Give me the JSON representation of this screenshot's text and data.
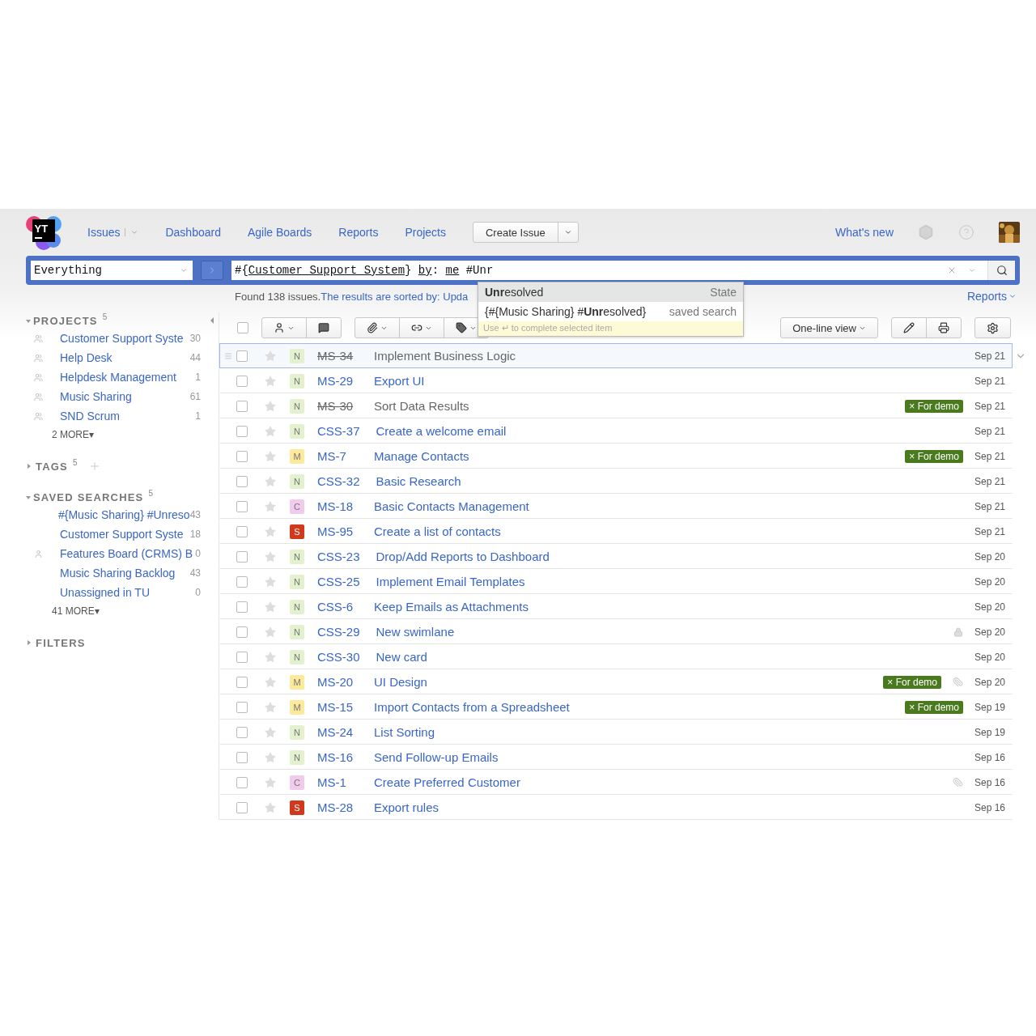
{
  "logo": {
    "text": "YT"
  },
  "nav": [
    {
      "label": "Issues",
      "has_menu": true
    },
    {
      "label": "Dashboard",
      "has_menu": false
    },
    {
      "label": "Agile Boards",
      "has_menu": false
    },
    {
      "label": "Reports",
      "has_menu": false
    },
    {
      "label": "Projects",
      "has_menu": false
    }
  ],
  "create_button": {
    "label": "Create Issue"
  },
  "whats_new": "What's new",
  "search": {
    "context": "Everything",
    "query": [
      {
        "text": "#{",
        "underlined": false
      },
      {
        "text": "Customer Support System",
        "underlined": true
      },
      {
        "text": "} ",
        "underlined": false
      },
      {
        "text": "by",
        "underlined": true
      },
      {
        "text": ": ",
        "underlined": false
      },
      {
        "text": "me",
        "underlined": true
      },
      {
        "text": " #Unr",
        "underlined": false
      }
    ]
  },
  "suggestions": {
    "items": [
      {
        "text": "**Unr**esolved",
        "type": "State",
        "selected": true
      },
      {
        "text": "{#{Music Sharing} #**Unr**esolved}",
        "type": "saved search",
        "selected": false
      }
    ],
    "hint": "Use ↵ to complete selected item"
  },
  "results": {
    "found": "Found 138 issues.",
    "sorted": "The results are sorted by: Upda",
    "reports": "Reports"
  },
  "sidebar": {
    "sections": [
      {
        "kind": "projects",
        "title": "PROJECTS",
        "count": "5",
        "expanded": true,
        "addable": false,
        "items": [
          {
            "name": "Customer Support Syste",
            "count": "30"
          },
          {
            "name": "Help Desk",
            "count": "44"
          },
          {
            "name": "Helpdesk Management",
            "count": "1"
          },
          {
            "name": "Music Sharing",
            "count": "61"
          },
          {
            "name": "SND Scrum",
            "count": "1"
          }
        ],
        "more": "2 MORE▾"
      },
      {
        "title": "TAGS",
        "count": "5",
        "expanded": false,
        "addable": true
      },
      {
        "kind": "searches",
        "title": "SAVED SEARCHES",
        "count": "5",
        "expanded": true,
        "addable": false,
        "items": [
          {
            "name": "#{Music Sharing} #Unreso",
            "count": "43",
            "kind": "shared"
          },
          {
            "name": "Customer Support Syste",
            "count": "18",
            "kind": "shared"
          },
          {
            "name": "Features Board (CRMS) B",
            "count": "0",
            "kind": "personal"
          },
          {
            "name": "Music Sharing Backlog",
            "count": "43",
            "kind": "shared"
          },
          {
            "name": "Unassigned in TU",
            "count": "0",
            "kind": "shared"
          }
        ],
        "more": "41 MORE▾"
      },
      {
        "title": "FILTERS",
        "expanded": false,
        "addable": false
      }
    ]
  },
  "select_all": {
    "checked": false
  },
  "view_button": "One-line view",
  "issues": [
    {
      "id": "MS-34",
      "summary": "Implement Business Logic",
      "priority": {
        "letter": "N",
        "color": "#e3f1cf"
      },
      "resolved": true,
      "selected": true,
      "checked": false,
      "locked": false,
      "attachment": false,
      "date": "Sep 21"
    },
    {
      "id": "MS-29",
      "summary": "Export UI",
      "priority": {
        "letter": "N",
        "color": "#e3f1cf"
      },
      "resolved": false,
      "selected": false,
      "checked": false,
      "locked": false,
      "attachment": false,
      "date": "Sep 21"
    },
    {
      "id": "MS-30",
      "summary": "Sort Data Results",
      "priority": {
        "letter": "N",
        "color": "#e3f1cf"
      },
      "resolved": true,
      "selected": false,
      "checked": false,
      "locked": false,
      "attachment": false,
      "tag": "× For demo",
      "date": "Sep 21"
    },
    {
      "id": "CSS-37",
      "summary": "Create a welcome email",
      "priority": {
        "letter": "N",
        "color": "#e3f1cf"
      },
      "resolved": false,
      "selected": false,
      "checked": false,
      "locked": false,
      "attachment": false,
      "date": "Sep 21"
    },
    {
      "id": "MS-7",
      "summary": "Manage Contacts",
      "priority": {
        "letter": "M",
        "color": "#fce99c"
      },
      "resolved": false,
      "selected": false,
      "checked": false,
      "locked": false,
      "attachment": false,
      "tag": "× For demo",
      "date": "Sep 21"
    },
    {
      "id": "CSS-32",
      "summary": "Basic Research",
      "priority": {
        "letter": "N",
        "color": "#e3f1cf"
      },
      "resolved": false,
      "selected": false,
      "checked": false,
      "locked": false,
      "attachment": false,
      "date": "Sep 21"
    },
    {
      "id": "MS-18",
      "summary": "Basic Contacts Management",
      "priority": {
        "letter": "C",
        "color": "#f1cbec"
      },
      "resolved": false,
      "selected": false,
      "checked": false,
      "locked": false,
      "attachment": false,
      "date": "Sep 21"
    },
    {
      "id": "MS-95",
      "summary": "Create a list of contacts",
      "priority": {
        "letter": "S",
        "color": "#cf3a1c"
      },
      "resolved": false,
      "selected": false,
      "checked": false,
      "locked": false,
      "attachment": false,
      "date": "Sep 21"
    },
    {
      "id": "CSS-23",
      "summary": "Drop/Add Reports to Dashboard",
      "priority": {
        "letter": "N",
        "color": "#e3f1cf"
      },
      "resolved": false,
      "selected": false,
      "checked": false,
      "locked": false,
      "attachment": false,
      "date": "Sep 20"
    },
    {
      "id": "CSS-25",
      "summary": "Implement Email Templates",
      "priority": {
        "letter": "N",
        "color": "#e3f1cf"
      },
      "resolved": false,
      "selected": false,
      "checked": false,
      "locked": false,
      "attachment": false,
      "date": "Sep 20"
    },
    {
      "id": "CSS-6",
      "summary": "Keep Emails as Attachments",
      "priority": {
        "letter": "N",
        "color": "#e3f1cf"
      },
      "resolved": false,
      "selected": false,
      "checked": false,
      "locked": false,
      "attachment": false,
      "date": "Sep 20"
    },
    {
      "id": "CSS-29",
      "summary": "New swimlane",
      "priority": {
        "letter": "N",
        "color": "#e3f1cf"
      },
      "resolved": false,
      "selected": false,
      "checked": false,
      "locked": true,
      "attachment": false,
      "date": "Sep 20"
    },
    {
      "id": "CSS-30",
      "summary": "New card",
      "priority": {
        "letter": "N",
        "color": "#e3f1cf"
      },
      "resolved": false,
      "selected": false,
      "checked": false,
      "locked": false,
      "attachment": false,
      "date": "Sep 20"
    },
    {
      "id": "MS-20",
      "summary": "UI Design",
      "priority": {
        "letter": "M",
        "color": "#fce99c"
      },
      "resolved": false,
      "selected": false,
      "checked": false,
      "locked": false,
      "attachment": true,
      "tag": "× For demo",
      "date": "Sep 20"
    },
    {
      "id": "MS-15",
      "summary": "Import Contacts from a Spreadsheet",
      "priority": {
        "letter": "M",
        "color": "#fce99c"
      },
      "resolved": false,
      "selected": false,
      "checked": false,
      "locked": false,
      "attachment": false,
      "tag": "× For demo",
      "date": "Sep 19"
    },
    {
      "id": "MS-24",
      "summary": "List Sorting",
      "priority": {
        "letter": "N",
        "color": "#e3f1cf"
      },
      "resolved": false,
      "selected": false,
      "checked": false,
      "locked": false,
      "attachment": false,
      "date": "Sep 19"
    },
    {
      "id": "MS-16",
      "summary": "Send Follow-up Emails",
      "priority": {
        "letter": "N",
        "color": "#e3f1cf"
      },
      "resolved": false,
      "selected": false,
      "checked": false,
      "locked": false,
      "attachment": false,
      "date": "Sep 16"
    },
    {
      "id": "MS-1",
      "summary": "Create Preferred Customer",
      "priority": {
        "letter": "C",
        "color": "#f1cbec"
      },
      "resolved": false,
      "selected": false,
      "checked": false,
      "locked": false,
      "attachment": true,
      "date": "Sep 16"
    },
    {
      "id": "MS-28",
      "summary": "Export rules",
      "priority": {
        "letter": "S",
        "color": "#cf3a1c"
      },
      "resolved": false,
      "selected": false,
      "checked": false,
      "locked": false,
      "attachment": false,
      "date": "Sep 16"
    }
  ]
}
